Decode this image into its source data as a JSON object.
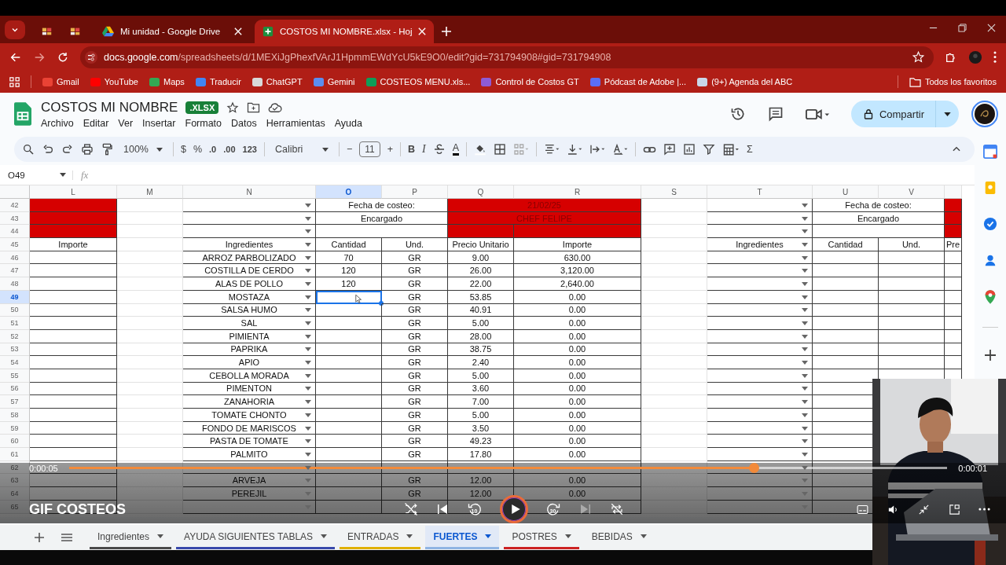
{
  "browser": {
    "tabs": [
      {
        "label": "Mi unidad - Google Drive",
        "selected": false
      },
      {
        "label": "COSTOS MI NOMBRE.xlsx - Hoj",
        "selected": true
      }
    ],
    "url": {
      "host": "docs.google.com",
      "path": "/spreadsheets/d/1MEXiJgPhexfVArJ1HpmmEWdYcU5kE9O0/edit?gid=731794908#gid=731794908"
    },
    "bookmarks": [
      {
        "label": "Gmail",
        "color": "#ea4335"
      },
      {
        "label": "YouTube",
        "color": "#ff0000"
      },
      {
        "label": "Maps",
        "color": "#34a853"
      },
      {
        "label": "Traducir",
        "color": "#4285f4"
      },
      {
        "label": "ChatGPT",
        "color": "#d9d9d9"
      },
      {
        "label": "Gemini",
        "color": "#5b8def"
      },
      {
        "label": "COSTEOS MENU.xls...",
        "color": "#0f9d58"
      },
      {
        "label": "Control de Costos GT",
        "color": "#8e5bd6"
      },
      {
        "label": "Pódcast de Adobe |...",
        "color": "#5b6ef5"
      },
      {
        "label": "(9+) Agenda del ABC",
        "color": "#c9d6e8"
      }
    ],
    "all_bookmarks": "Todos los favoritos"
  },
  "doc": {
    "title": "COSTOS MI NOMBRE",
    "badge": ".XLSX",
    "menu": [
      "Archivo",
      "Editar",
      "Ver",
      "Insertar",
      "Formato",
      "Datos",
      "Herramientas",
      "Ayuda"
    ],
    "share": "Compartir"
  },
  "toolbar": {
    "zoom": "100%",
    "currency": "$",
    "percent": "%",
    "dec_less": ".0",
    "dec_more": ".00",
    "number_format": "123",
    "font": "Calibri",
    "minus": "−",
    "font_size": "11",
    "plus": "+",
    "bold": "B",
    "italic": "I",
    "text_color": "A",
    "sum": "Σ"
  },
  "formula_bar": {
    "cell": "O49",
    "fx": "fx"
  },
  "grid": {
    "columns": [
      {
        "label": "L",
        "selected": false,
        "dropdown": false
      },
      {
        "label": "M",
        "selected": false,
        "dropdown": false
      },
      {
        "label": "N",
        "selected": false,
        "dropdown": true
      },
      {
        "label": "O",
        "selected": true,
        "dropdown": false
      },
      {
        "label": "P",
        "selected": false,
        "dropdown": false
      },
      {
        "label": "Q",
        "selected": false,
        "dropdown": false
      },
      {
        "label": "R",
        "selected": false,
        "dropdown": false
      },
      {
        "label": "S",
        "selected": false,
        "dropdown": false
      },
      {
        "label": "T",
        "selected": false,
        "dropdown": true
      },
      {
        "label": "U",
        "selected": false,
        "dropdown": false
      },
      {
        "label": "V",
        "selected": false,
        "dropdown": false
      }
    ],
    "rows": [
      {
        "number": "42",
        "selected": false,
        "cells": [
          {
            "kind": "fill"
          },
          {
            "kind": "plain"
          },
          {
            "kind": "plain"
          },
          {
            "kind": "merged",
            "text": "Fecha de costeo:"
          },
          {
            "kind": "mergedfill",
            "text": "21/02/25"
          },
          {
            "kind": "plain"
          },
          {
            "kind": "plain"
          },
          {
            "kind": "merged",
            "text": "Fecha de costeo:"
          },
          {
            "kind": "fill"
          }
        ]
      },
      {
        "number": "43",
        "selected": false,
        "cells": [
          {
            "kind": "fill"
          },
          {
            "kind": "plain"
          },
          {
            "kind": "plain"
          },
          {
            "kind": "merged",
            "text": "Encargado"
          },
          {
            "kind": "mergedfill",
            "text": "CHEF FELIPE"
          },
          {
            "kind": "plain"
          },
          {
            "kind": "plain"
          },
          {
            "kind": "merged",
            "text": "Encargado"
          },
          {
            "kind": "fill"
          }
        ]
      },
      {
        "number": "44",
        "selected": false,
        "cells": [
          {
            "kind": "fill"
          },
          {
            "kind": "plain"
          },
          {
            "kind": "plain"
          },
          {
            "kind": "merged"
          },
          {
            "kind": "fill"
          },
          {
            "kind": "fill"
          },
          {
            "kind": "plain"
          },
          {
            "kind": "plain"
          },
          {
            "kind": "merged"
          },
          {
            "kind": "fill"
          }
        ]
      },
      {
        "number": "45",
        "selected": false,
        "cells": [
          {
            "kind": "plain",
            "text": "Importe"
          },
          {
            "kind": "plain"
          },
          {
            "kind": "plain",
            "text": "Ingredientes"
          },
          {
            "kind": "plain",
            "text": "Cantidad"
          },
          {
            "kind": "plain",
            "text": "Und."
          },
          {
            "kind": "plain",
            "text": "Precio Unitario"
          },
          {
            "kind": "plain",
            "text": "Importe"
          },
          {
            "kind": "plain"
          },
          {
            "kind": "plain",
            "text": "Ingredientes"
          },
          {
            "kind": "plain",
            "text": "Cantidad"
          },
          {
            "kind": "plain",
            "text": "Und."
          },
          {
            "kind": "plain",
            "text": "Pre"
          }
        ]
      },
      {
        "number": "46",
        "selected": false,
        "cells": [
          {
            "kind": "plain"
          },
          {
            "kind": "plain"
          },
          {
            "kind": "plain",
            "text": "ARROZ PARBOLIZADO"
          },
          {
            "kind": "plain",
            "text": "70"
          },
          {
            "kind": "plain",
            "text": "GR"
          },
          {
            "kind": "plain",
            "text": "9.00"
          },
          {
            "kind": "plain",
            "text": "630.00"
          }
        ]
      },
      {
        "number": "47",
        "selected": false,
        "cells": [
          {
            "kind": "plain"
          },
          {
            "kind": "plain"
          },
          {
            "kind": "plain",
            "text": "COSTILLA DE CERDO"
          },
          {
            "kind": "plain",
            "text": "120"
          },
          {
            "kind": "plain",
            "text": "GR"
          },
          {
            "kind": "plain",
            "text": "26.00"
          },
          {
            "kind": "plain",
            "text": "3,120.00"
          }
        ]
      },
      {
        "number": "48",
        "selected": false,
        "cells": [
          {
            "kind": "plain"
          },
          {
            "kind": "plain"
          },
          {
            "kind": "plain",
            "text": "ALAS DE POLLO"
          },
          {
            "kind": "plain",
            "text": "120"
          },
          {
            "kind": "plain",
            "text": "GR"
          },
          {
            "kind": "plain",
            "text": "22.00"
          },
          {
            "kind": "plain",
            "text": "2,640.00"
          }
        ]
      },
      {
        "number": "49",
        "selected": true,
        "cells": [
          {
            "kind": "plain"
          },
          {
            "kind": "plain"
          },
          {
            "kind": "plain",
            "text": "MOSTAZA"
          },
          {
            "kind": "cursor"
          },
          {
            "kind": "plain",
            "text": "GR"
          },
          {
            "kind": "plain",
            "text": "53.85"
          },
          {
            "kind": "plain",
            "text": "0.00"
          }
        ]
      },
      {
        "number": "50",
        "selected": false,
        "cells": [
          {
            "kind": "plain"
          },
          {
            "kind": "plain"
          },
          {
            "kind": "plain",
            "text": "SALSA HUMO"
          },
          {
            "kind": "plain"
          },
          {
            "kind": "plain",
            "text": "GR"
          },
          {
            "kind": "plain",
            "text": "40.91"
          },
          {
            "kind": "plain",
            "text": "0.00"
          }
        ]
      },
      {
        "number": "51",
        "selected": false,
        "cells": [
          {
            "kind": "plain"
          },
          {
            "kind": "plain"
          },
          {
            "kind": "plain",
            "text": "SAL"
          },
          {
            "kind": "plain"
          },
          {
            "kind": "plain",
            "text": "GR"
          },
          {
            "kind": "plain",
            "text": "5.00"
          },
          {
            "kind": "plain",
            "text": "0.00"
          }
        ]
      },
      {
        "number": "52",
        "selected": false,
        "cells": [
          {
            "kind": "plain"
          },
          {
            "kind": "plain"
          },
          {
            "kind": "plain",
            "text": "PIMIENTA"
          },
          {
            "kind": "plain"
          },
          {
            "kind": "plain",
            "text": "GR"
          },
          {
            "kind": "plain",
            "text": "28.00"
          },
          {
            "kind": "plain",
            "text": "0.00"
          }
        ]
      },
      {
        "number": "53",
        "selected": false,
        "cells": [
          {
            "kind": "plain"
          },
          {
            "kind": "plain"
          },
          {
            "kind": "plain",
            "text": "PAPRIKA"
          },
          {
            "kind": "plain"
          },
          {
            "kind": "plain",
            "text": "GR"
          },
          {
            "kind": "plain",
            "text": "38.75"
          },
          {
            "kind": "plain",
            "text": "0.00"
          }
        ]
      },
      {
        "number": "54",
        "selected": false,
        "cells": [
          {
            "kind": "plain"
          },
          {
            "kind": "plain"
          },
          {
            "kind": "plain",
            "text": "APIO"
          },
          {
            "kind": "plain"
          },
          {
            "kind": "plain",
            "text": "GR"
          },
          {
            "kind": "plain",
            "text": "2.40"
          },
          {
            "kind": "plain",
            "text": "0.00"
          }
        ]
      },
      {
        "number": "55",
        "selected": false,
        "cells": [
          {
            "kind": "plain"
          },
          {
            "kind": "plain"
          },
          {
            "kind": "plain",
            "text": "CEBOLLA MORADA"
          },
          {
            "kind": "plain"
          },
          {
            "kind": "plain",
            "text": "GR"
          },
          {
            "kind": "plain",
            "text": "5.00"
          },
          {
            "kind": "plain",
            "text": "0.00"
          }
        ]
      },
      {
        "number": "56",
        "selected": false,
        "cells": [
          {
            "kind": "plain"
          },
          {
            "kind": "plain"
          },
          {
            "kind": "plain",
            "text": "PIMENTON"
          },
          {
            "kind": "plain"
          },
          {
            "kind": "plain",
            "text": "GR"
          },
          {
            "kind": "plain",
            "text": "3.60"
          },
          {
            "kind": "plain",
            "text": "0.00"
          }
        ]
      },
      {
        "number": "57",
        "selected": false,
        "cells": [
          {
            "kind": "plain"
          },
          {
            "kind": "plain"
          },
          {
            "kind": "plain",
            "text": "ZANAHORIA"
          },
          {
            "kind": "plain"
          },
          {
            "kind": "plain",
            "text": "GR"
          },
          {
            "kind": "plain",
            "text": "7.00"
          },
          {
            "kind": "plain",
            "text": "0.00"
          }
        ]
      },
      {
        "number": "58",
        "selected": false,
        "cells": [
          {
            "kind": "plain"
          },
          {
            "kind": "plain"
          },
          {
            "kind": "plain",
            "text": "TOMATE CHONTO"
          },
          {
            "kind": "plain"
          },
          {
            "kind": "plain",
            "text": "GR"
          },
          {
            "kind": "plain",
            "text": "5.00"
          },
          {
            "kind": "plain",
            "text": "0.00"
          }
        ]
      },
      {
        "number": "59",
        "selected": false,
        "cells": [
          {
            "kind": "plain"
          },
          {
            "kind": "plain"
          },
          {
            "kind": "plain",
            "text": "FONDO DE MARISCOS"
          },
          {
            "kind": "plain"
          },
          {
            "kind": "plain",
            "text": "GR"
          },
          {
            "kind": "plain",
            "text": "3.50"
          },
          {
            "kind": "plain",
            "text": "0.00"
          }
        ]
      },
      {
        "number": "60",
        "selected": false,
        "cells": [
          {
            "kind": "plain"
          },
          {
            "kind": "plain"
          },
          {
            "kind": "plain",
            "text": "PASTA DE TOMATE"
          },
          {
            "kind": "plain"
          },
          {
            "kind": "plain",
            "text": "GR"
          },
          {
            "kind": "plain",
            "text": "49.23"
          },
          {
            "kind": "plain",
            "text": "0.00"
          }
        ]
      },
      {
        "number": "61",
        "selected": false,
        "cells": [
          {
            "kind": "plain"
          },
          {
            "kind": "plain"
          },
          {
            "kind": "plain",
            "text": "PALMITO"
          },
          {
            "kind": "plain"
          },
          {
            "kind": "plain",
            "text": "GR"
          },
          {
            "kind": "plain",
            "text": "17.80"
          },
          {
            "kind": "plain",
            "text": "0.00"
          }
        ]
      },
      {
        "number": "62",
        "selected": false,
        "cells": [
          {
            "kind": "plain"
          },
          {
            "kind": "plain"
          },
          {
            "kind": "plain"
          }
        ]
      },
      {
        "number": "63",
        "selected": false,
        "cells": [
          {
            "kind": "plain"
          },
          {
            "kind": "plain"
          },
          {
            "kind": "plain",
            "text": "ARVEJA"
          },
          {
            "kind": "plain"
          },
          {
            "kind": "plain",
            "text": "GR"
          },
          {
            "kind": "plain",
            "text": "12.00"
          },
          {
            "kind": "plain",
            "text": "0.00"
          }
        ]
      },
      {
        "number": "64",
        "selected": false,
        "cells": [
          {
            "kind": "plain"
          },
          {
            "kind": "plain"
          },
          {
            "kind": "plain",
            "text": "PEREJIL"
          },
          {
            "kind": "plain"
          },
          {
            "kind": "plain",
            "text": "GR"
          },
          {
            "kind": "plain",
            "text": "12.00"
          },
          {
            "kind": "plain",
            "text": "0.00"
          }
        ]
      },
      {
        "number": "65",
        "selected": false,
        "cells": [
          {
            "kind": "plain"
          },
          {
            "kind": "plain"
          },
          {
            "kind": "plain"
          }
        ]
      }
    ]
  },
  "sheets": [
    {
      "label": "Ingredientes",
      "selected": false,
      "color": "#4a4a4a"
    },
    {
      "label": "AYUDA SIGUIENTES TABLAS",
      "selected": false,
      "color": "#3949ab"
    },
    {
      "label": "ENTRADAS",
      "selected": false,
      "color": "#e0b000"
    },
    {
      "label": "FUERTES",
      "selected": true,
      "color": "#8fb4e3"
    },
    {
      "label": "POSTRES",
      "selected": false,
      "color": "#cc2222"
    },
    {
      "label": "BEBIDAS",
      "selected": false
    }
  ],
  "player": {
    "title": "GIF COSTEOS",
    "elapsed": "0:00:05",
    "remaining": "0:00:01",
    "level": 0.78,
    "rewind": "10",
    "forward": "30",
    "playing": false,
    "next_disabled": true
  }
}
